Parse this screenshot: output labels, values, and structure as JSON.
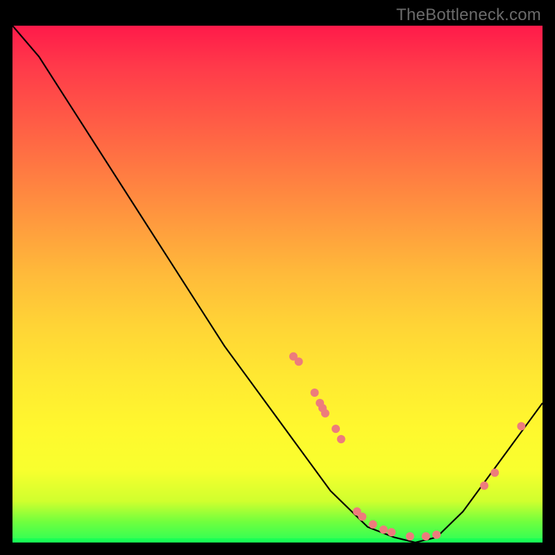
{
  "watermark": "TheBottleneck.com",
  "chart_data": {
    "type": "line",
    "title": "",
    "xlabel": "",
    "ylabel": "",
    "xlim": [
      0,
      100
    ],
    "ylim": [
      0,
      100
    ],
    "series": [
      {
        "name": "curve",
        "x": [
          0,
          5,
          10,
          15,
          20,
          25,
          30,
          35,
          40,
          45,
          50,
          55,
          60,
          62,
          67,
          72,
          76,
          80,
          85,
          90,
          95,
          100
        ],
        "y": [
          100,
          94,
          86,
          78,
          70,
          62,
          54,
          46,
          38,
          31,
          24,
          17,
          10,
          8,
          3,
          1,
          0,
          1,
          6,
          13,
          20,
          27
        ]
      }
    ],
    "markers": [
      {
        "x": 53,
        "y": 36,
        "r": 6
      },
      {
        "x": 54,
        "y": 35,
        "r": 6
      },
      {
        "x": 57,
        "y": 29,
        "r": 6
      },
      {
        "x": 58,
        "y": 27,
        "r": 6
      },
      {
        "x": 58.5,
        "y": 26,
        "r": 6
      },
      {
        "x": 59,
        "y": 25,
        "r": 6
      },
      {
        "x": 61,
        "y": 22,
        "r": 6
      },
      {
        "x": 62,
        "y": 20,
        "r": 6
      },
      {
        "x": 65,
        "y": 6,
        "r": 6
      },
      {
        "x": 66,
        "y": 5,
        "r": 6
      },
      {
        "x": 68,
        "y": 3.5,
        "r": 6
      },
      {
        "x": 70,
        "y": 2.5,
        "r": 6
      },
      {
        "x": 71.5,
        "y": 2,
        "r": 6
      },
      {
        "x": 75,
        "y": 1.2,
        "r": 6
      },
      {
        "x": 78,
        "y": 1.2,
        "r": 6
      },
      {
        "x": 80,
        "y": 1.5,
        "r": 6
      },
      {
        "x": 89,
        "y": 11,
        "r": 6
      },
      {
        "x": 91,
        "y": 13.5,
        "r": 6
      },
      {
        "x": 96,
        "y": 22.5,
        "r": 6
      }
    ],
    "marker_color": "#ed7c7c",
    "curve_color": "#000000",
    "background_gradient": {
      "top": "#ff1a4a",
      "mid": "#fff82e",
      "bottom": "#2aff58"
    }
  }
}
